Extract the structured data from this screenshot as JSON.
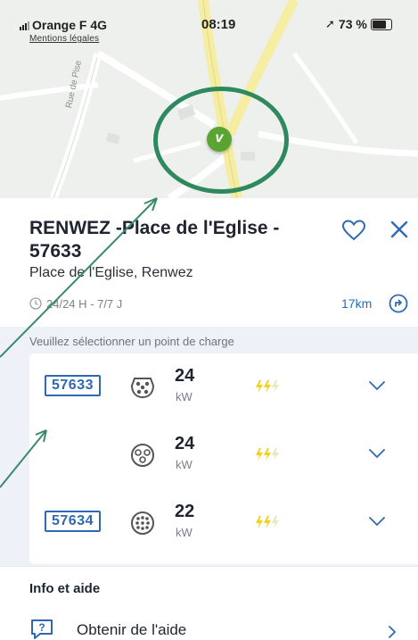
{
  "status_bar": {
    "carrier": "Orange F",
    "network": "4G",
    "time": "08:19",
    "battery": "73 %"
  },
  "map": {
    "legal_link": "Mentions légales",
    "street_label": "Rue de Pise",
    "pin_glyph": "v",
    "pin_color": "#5aa532",
    "highlight_color": "#2e8a5e"
  },
  "station": {
    "title": "RENWEZ -Place de l'Eglise - 57633",
    "address": "Place de l'Eglise, Renwez",
    "hours": "24/24 H - 7/7 J",
    "distance": "17km"
  },
  "charge_points": {
    "prompt": "Veuillez sélectionner un point de charge",
    "accent_color": "#2f69b3",
    "items": [
      {
        "id": "57633",
        "power": "24",
        "unit": "kW",
        "socket_icon": "type2-socket-icon"
      },
      {
        "id": "",
        "power": "24",
        "unit": "kW",
        "socket_icon": "combo-socket-icon"
      },
      {
        "id": "57634",
        "power": "22",
        "unit": "kW",
        "socket_icon": "chademo-socket-icon"
      }
    ]
  },
  "info": {
    "title": "Info et aide",
    "help_label": "Obtenir de l'aide"
  }
}
